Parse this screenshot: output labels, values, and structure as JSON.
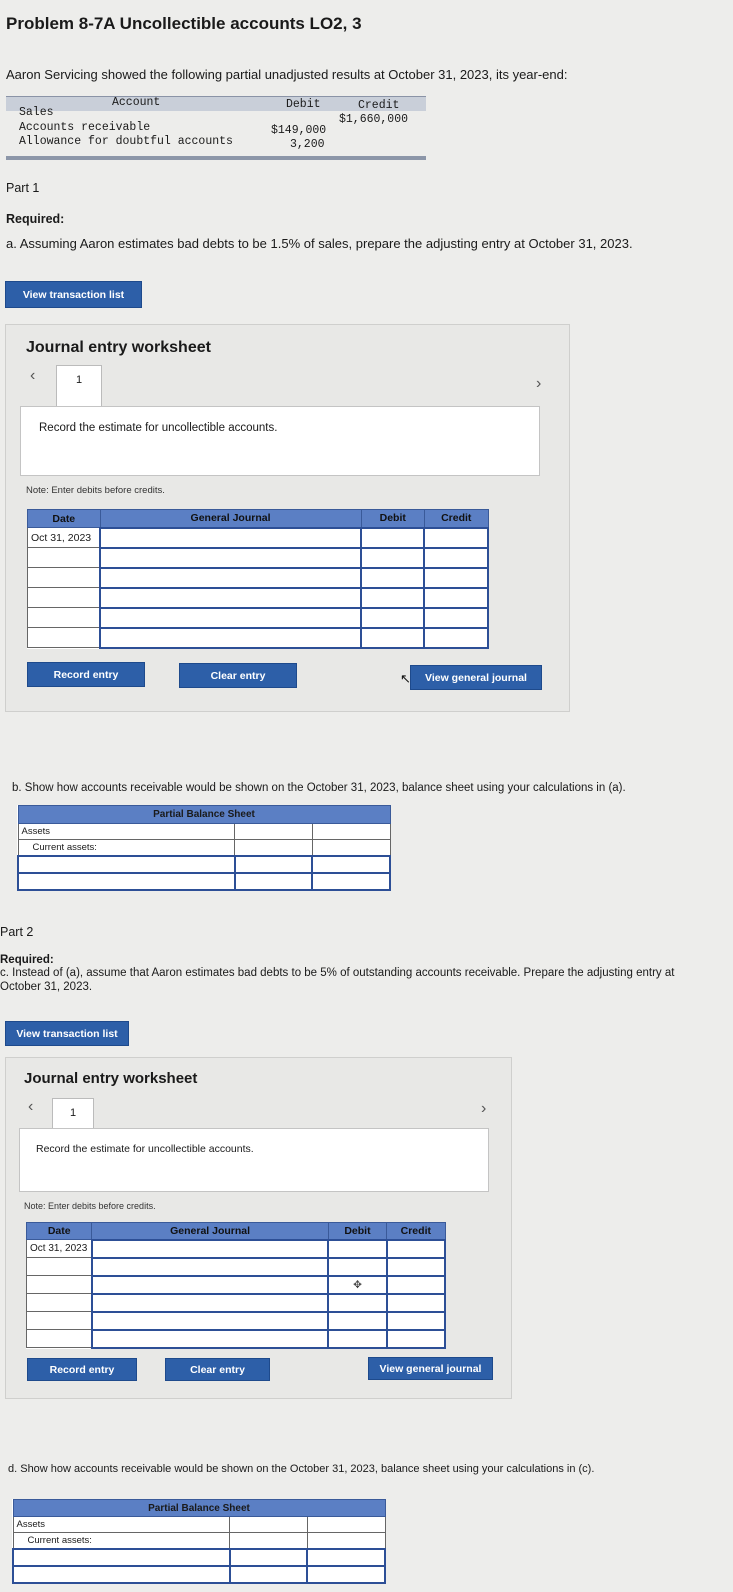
{
  "title": "Problem 8-7A Uncollectible accounts LO2, 3",
  "intro": "Aaron Servicing showed the following partial unadjusted results at October 31, 2023, its year-end:",
  "accounts_table": {
    "headers": [
      "Account",
      "Debit",
      "Credit"
    ],
    "rows": [
      {
        "account": "Sales",
        "debit": "",
        "credit": "$1,660,000"
      },
      {
        "account": "Accounts receivable",
        "debit": "$149,000",
        "credit": ""
      },
      {
        "account": "Allowance for doubtful accounts",
        "debit": "3,200",
        "credit": ""
      }
    ]
  },
  "part1": {
    "label": "Part 1",
    "required_label": "Required:",
    "required_a": "a. Assuming Aaron estimates bad debts to be 1.5% of sales, prepare the adjusting entry at October 31, 2023.",
    "view_transaction_list": "View transaction list",
    "worksheet": {
      "title": "Journal entry worksheet",
      "tab": "1",
      "description": "Record the estimate for uncollectible accounts.",
      "note": "Note: Enter debits before credits.",
      "headers": [
        "Date",
        "General Journal",
        "Debit",
        "Credit"
      ],
      "first_date": "Oct 31, 2023",
      "record_entry": "Record entry",
      "clear_entry": "Clear entry",
      "view_general_journal": "View general journal"
    },
    "question_b": "b. Show how accounts receivable would be shown on the October 31, 2023, balance sheet using your calculations in (a).",
    "balance_sheet": {
      "title": "Partial Balance Sheet",
      "assets": "Assets",
      "current_assets": "Current assets:"
    }
  },
  "part2": {
    "label": "Part 2",
    "required_label": "Required:",
    "required_c_line1": "c. Instead of (a), assume that Aaron estimates bad debts to be 5% of outstanding accounts receivable. Prepare the adjusting entry at",
    "required_c_line2": "October 31, 2023.",
    "view_transaction_list": "View transaction list",
    "worksheet": {
      "title": "Journal entry worksheet",
      "tab": "1",
      "description": "Record the estimate for uncollectible accounts.",
      "note": "Note: Enter debits before credits.",
      "headers": [
        "Date",
        "General Journal",
        "Debit",
        "Credit"
      ],
      "first_date": "Oct 31, 2023",
      "record_entry": "Record entry",
      "clear_entry": "Clear entry",
      "view_general_journal": "View general journal"
    },
    "question_d": "d. Show how accounts receivable would be shown on the October 31, 2023, balance sheet using your calculations in (c).",
    "balance_sheet": {
      "title": "Partial Balance Sheet",
      "assets": "Assets",
      "current_assets": "Current assets:"
    }
  },
  "icons": {
    "prev": "chevron-left-icon",
    "next": "chevron-right-icon",
    "pointer": "mouse-pointer-icon",
    "move": "move-cursor-icon"
  },
  "colors": {
    "button": "#2d5fa8",
    "table_header": "#5b7fc4"
  }
}
